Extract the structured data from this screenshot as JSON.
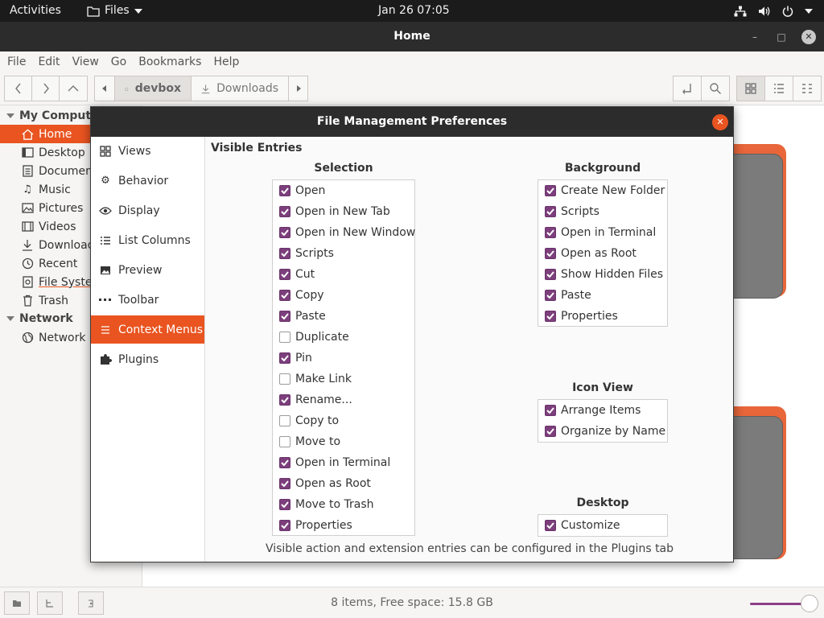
{
  "topbar": {
    "activities": "Activities",
    "app_menu": "Files",
    "clock": "Jan 26  07:05"
  },
  "window": {
    "title": "Home"
  },
  "menubar": {
    "items": [
      "File",
      "Edit",
      "View",
      "Go",
      "Bookmarks",
      "Help"
    ]
  },
  "toolbar": {
    "breadcrumbs": [
      "devbox",
      "Downloads"
    ]
  },
  "sidebar": {
    "my_computer": "My Computer",
    "items": [
      {
        "label": "Home",
        "icon": "home-icon"
      },
      {
        "label": "Desktop",
        "icon": "desktop-icon"
      },
      {
        "label": "Documents",
        "icon": "document-icon"
      },
      {
        "label": "Music",
        "icon": "music-icon"
      },
      {
        "label": "Pictures",
        "icon": "pictures-icon"
      },
      {
        "label": "Videos",
        "icon": "videos-icon"
      },
      {
        "label": "Downloads",
        "icon": "download-icon"
      },
      {
        "label": "Recent",
        "icon": "recent-icon"
      },
      {
        "label": "File System",
        "icon": "drive-icon"
      },
      {
        "label": "Trash",
        "icon": "trash-icon"
      }
    ],
    "network_heading": "Network",
    "network_items": [
      {
        "label": "Network",
        "icon": "network-icon"
      }
    ]
  },
  "statusbar": {
    "text": "8 items, Free space: 15.8 GB"
  },
  "dialog": {
    "title": "File Management Preferences",
    "nav": [
      {
        "label": "Views",
        "icon": "views-icon"
      },
      {
        "label": "Behavior",
        "icon": "gear-icon"
      },
      {
        "label": "Display",
        "icon": "eye-icon"
      },
      {
        "label": "List Columns",
        "icon": "list-icon"
      },
      {
        "label": "Preview",
        "icon": "image-icon"
      },
      {
        "label": "Toolbar",
        "icon": "dots-icon"
      },
      {
        "label": "Context Menus",
        "icon": "menu-icon"
      },
      {
        "label": "Plugins",
        "icon": "puzzle-icon"
      }
    ],
    "section_title": "Visible Entries",
    "selection": {
      "title": "Selection",
      "items": [
        {
          "label": "Open",
          "checked": true
        },
        {
          "label": "Open in New Tab",
          "checked": true
        },
        {
          "label": "Open in New Window",
          "checked": true
        },
        {
          "label": "Scripts",
          "checked": true
        },
        {
          "label": "Cut",
          "checked": true
        },
        {
          "label": "Copy",
          "checked": true
        },
        {
          "label": "Paste",
          "checked": true
        },
        {
          "label": "Duplicate",
          "checked": false
        },
        {
          "label": "Pin",
          "checked": true
        },
        {
          "label": "Make Link",
          "checked": false
        },
        {
          "label": "Rename...",
          "checked": true
        },
        {
          "label": "Copy to",
          "checked": false
        },
        {
          "label": "Move to",
          "checked": false
        },
        {
          "label": "Open in Terminal",
          "checked": true
        },
        {
          "label": "Open as Root",
          "checked": true
        },
        {
          "label": "Move to Trash",
          "checked": true
        },
        {
          "label": "Properties",
          "checked": true
        }
      ]
    },
    "background": {
      "title": "Background",
      "items": [
        {
          "label": "Create New Folder",
          "checked": true
        },
        {
          "label": "Scripts",
          "checked": true
        },
        {
          "label": "Open in Terminal",
          "checked": true
        },
        {
          "label": "Open as Root",
          "checked": true
        },
        {
          "label": "Show Hidden Files",
          "checked": true
        },
        {
          "label": "Paste",
          "checked": true
        },
        {
          "label": "Properties",
          "checked": true
        }
      ]
    },
    "icon_view": {
      "title": "Icon View",
      "items": [
        {
          "label": "Arrange Items",
          "checked": true
        },
        {
          "label": "Organize by Name",
          "checked": true
        }
      ]
    },
    "desktop": {
      "title": "Desktop",
      "items": [
        {
          "label": "Customize",
          "checked": true
        }
      ]
    },
    "footer": "Visible action and extension entries can be configured in the Plugins tab"
  },
  "colors": {
    "accent": "#e95420",
    "checkbox": "#7c3f7c",
    "titlebar": "#2c2c2c"
  }
}
